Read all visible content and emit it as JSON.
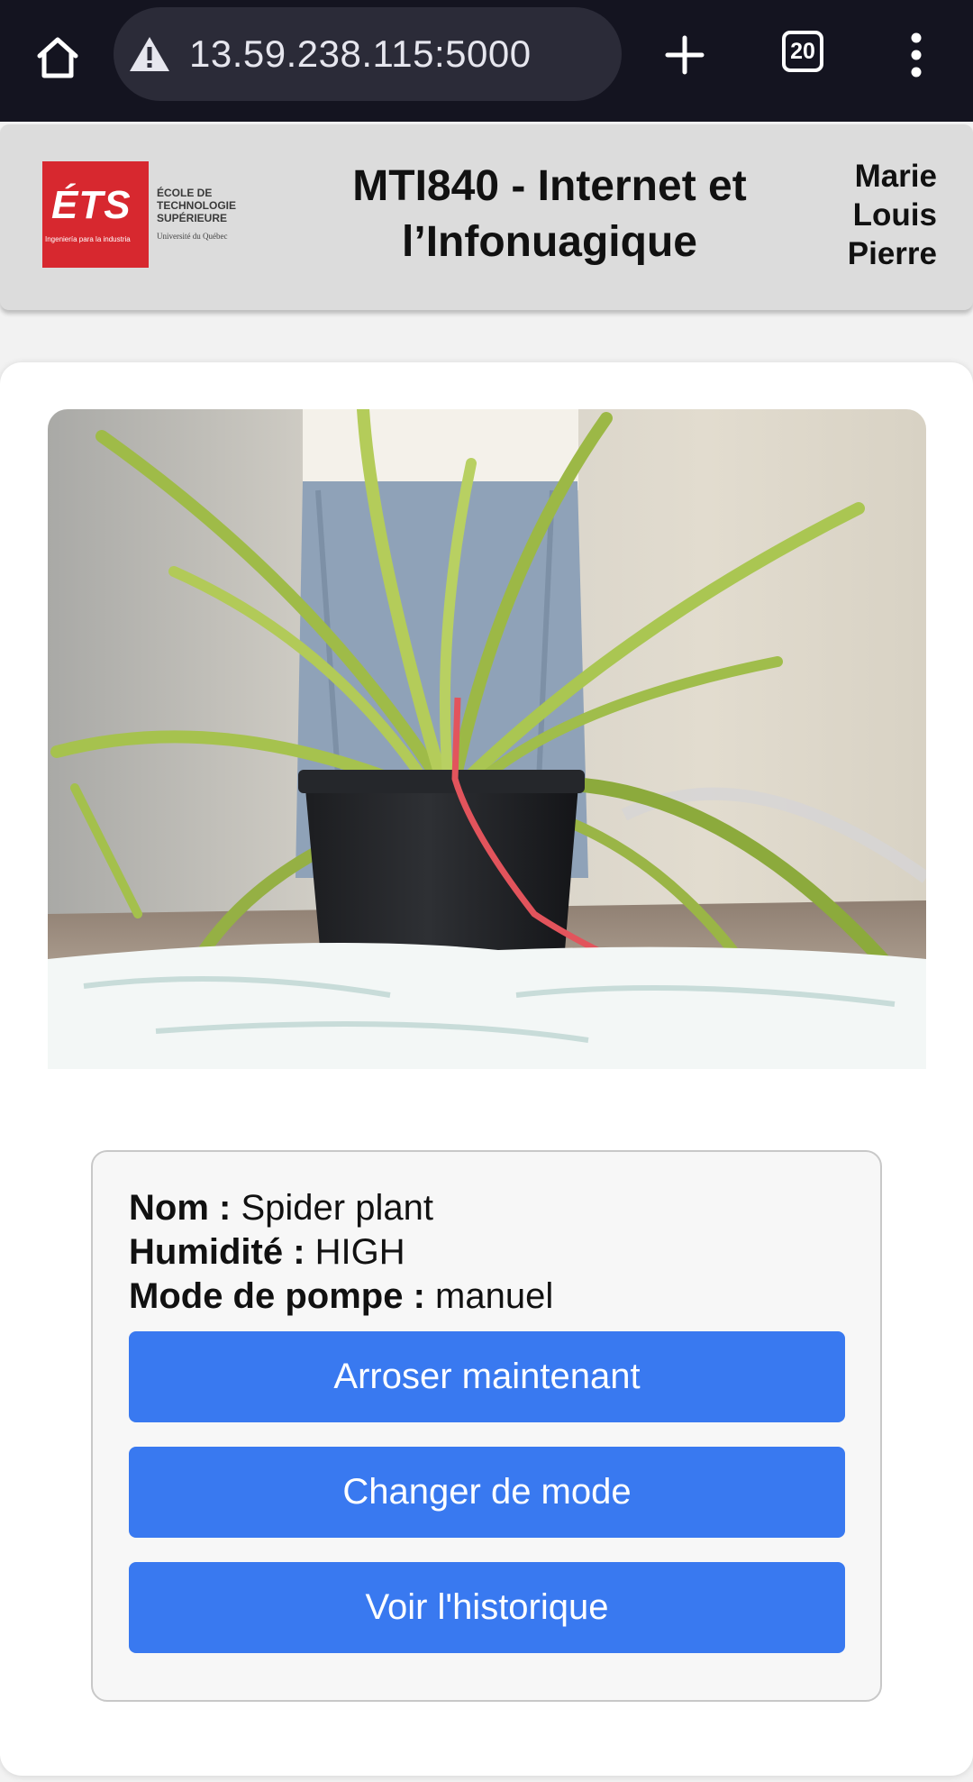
{
  "browser": {
    "url": "13.59.238.115:5000",
    "tab_count": "20",
    "icons": [
      "home-icon",
      "warning-icon",
      "plus-icon",
      "tab-switcher-icon",
      "more-vert-icon"
    ]
  },
  "header": {
    "logo": {
      "mark": "ÉTS",
      "tagline": "Ingeniería para la industria",
      "school_lines": [
        "ÉCOLE DE",
        "TECHNOLOGIE",
        "SUPÉRIEURE"
      ],
      "university": "Université du Québec"
    },
    "title": "MTI840 - Internet et l’Infonuagique",
    "team_members": [
      "Marie",
      "Louis",
      "Pierre"
    ]
  },
  "plant": {
    "name_label": "Nom :",
    "name_value": "Spider plant",
    "humidity_label": "Humidité :",
    "humidity_value": "HIGH",
    "pump_mode_label": "Mode de pompe :",
    "pump_mode_value": "manuel"
  },
  "actions": {
    "water_now": "Arroser maintenant",
    "change_mode": "Changer de mode",
    "view_history": "Voir l'historique"
  },
  "colors": {
    "browser_bar": "#141420",
    "address_bar": "#2b2b38",
    "header_bg": "#dcdcdc",
    "page_bg": "#f2f2f2",
    "logo_red": "#d7282f",
    "button_blue": "#3979f0"
  }
}
